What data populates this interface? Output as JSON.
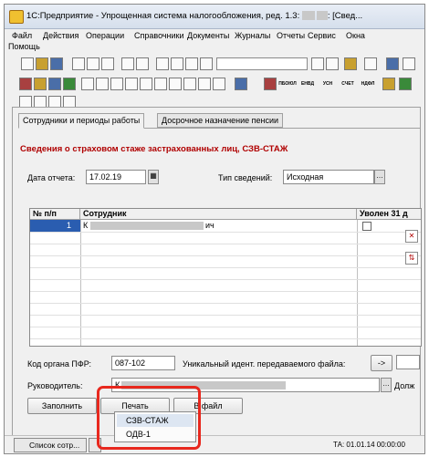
{
  "window": {
    "title_prefix": "1С:Предприятие - Упрощенная система налогообложения, ред. 1.3: ",
    "title_suffix": ": [Свед..."
  },
  "menu": [
    {
      "label": "Файл"
    },
    {
      "label": "Действия"
    },
    {
      "label": "Операции"
    },
    {
      "label": "Справочники"
    },
    {
      "label": "Документы"
    },
    {
      "label": "Журналы"
    },
    {
      "label": "Отчеты"
    },
    {
      "label": "Сервис"
    },
    {
      "label": "Окна"
    },
    {
      "label": "Помощь"
    }
  ],
  "toolbar2_labels": [
    "ПБОЮЛ",
    "ЕНВД",
    "УСН",
    "СЧЕТ",
    "НДФЛ"
  ],
  "tabs": [
    {
      "label": "Сотрудники и периоды работы"
    },
    {
      "label": "Досрочное назначение пенсии"
    }
  ],
  "form": {
    "heading": "Сведения о страховом стаже застрахованных лиц, СЗВ-СТАЖ",
    "report_date_label": "Дата отчета:",
    "report_date_value": "17.02.19",
    "info_type_label": "Тип сведений:",
    "info_type_value": "Исходная",
    "pfr_code_label": "Код органа ПФР:",
    "pfr_code_value": "087-102",
    "file_id_label": "Уникальный идент. передаваемого файла:",
    "file_id_button": "->",
    "head_label": "Руководитель:",
    "head_value": "К",
    "position_label": "Долж"
  },
  "grid": {
    "columns": [
      "№ п/п",
      "Сотрудник",
      "Уволен 31 д"
    ],
    "rows": [
      {
        "num": "1",
        "employee_start": "К",
        "employee_end": "ич"
      }
    ]
  },
  "buttons": {
    "fill": "Заполнить",
    "print": "Печать",
    "to_file": "В файл"
  },
  "print_menu": [
    {
      "label": "СЗВ-СТАЖ"
    },
    {
      "label": "ОДВ-1"
    }
  ],
  "statusbar": {
    "task_label": "Список сотр...",
    "ta_label": "ТА: 01.01.14 00:00:00"
  }
}
